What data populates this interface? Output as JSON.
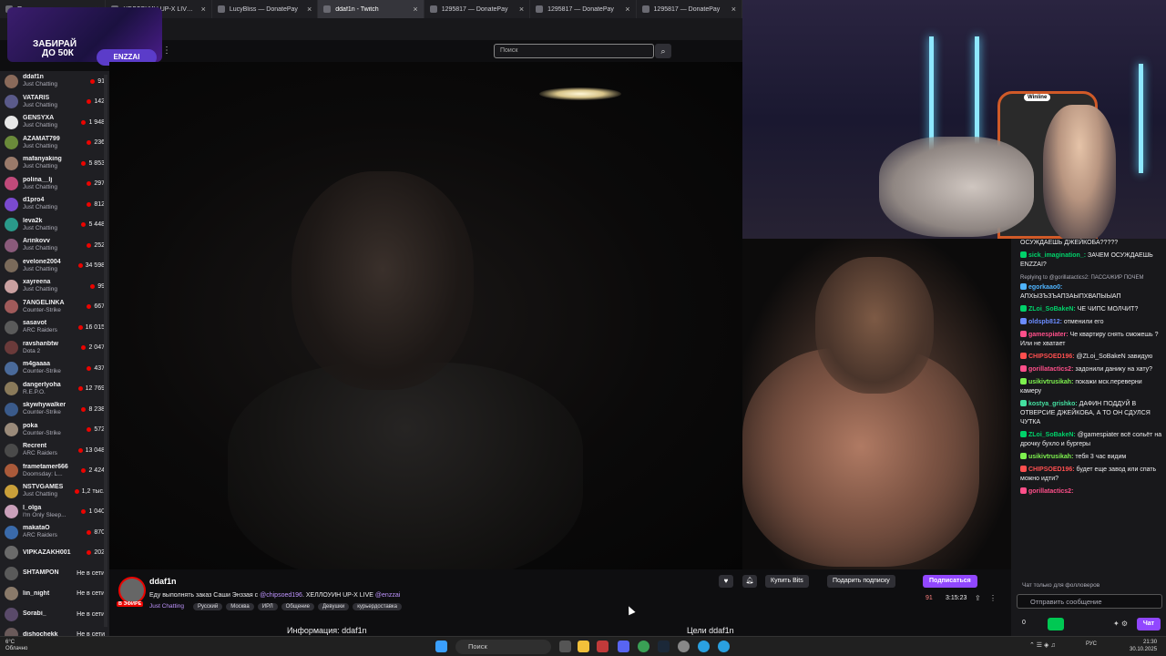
{
  "browser": {
    "tabs": [
      {
        "title": "Панель управления - Donatio",
        "active": false
      },
      {
        "title": "ХЕЛЛОУИН UP-X LIVE - Twitch",
        "active": false
      },
      {
        "title": "LucyBliss — DonatePay",
        "active": false
      },
      {
        "title": "ddaf1n - Twitch",
        "active": true
      },
      {
        "title": "1295817 — DonatePay",
        "active": false
      },
      {
        "title": "1295817 — DonatePay",
        "active": false
      },
      {
        "title": "1295817 — DonatePay",
        "active": false
      }
    ]
  },
  "promo": {
    "line1": "ЗАБИРАЙ",
    "line2": "ДО 50К",
    "badge": "ENZZAI"
  },
  "search": {
    "placeholder": "Поиск"
  },
  "sidebar": {
    "channels": [
      {
        "name": "ddaf1n",
        "category": "Just Chatting",
        "viewers": "91",
        "color": "#8a6a5a"
      },
      {
        "name": "VATARIS",
        "category": "Just Chatting",
        "viewers": "142",
        "color": "#5a5a8a"
      },
      {
        "name": "GENSYXA",
        "category": "Just Chatting",
        "viewers": "1 948",
        "color": "#e8e8e8"
      },
      {
        "name": "AZAMAT799",
        "category": "Just Chatting",
        "viewers": "236",
        "color": "#6a8a3a"
      },
      {
        "name": "mafanyaking",
        "category": "Just Chatting",
        "viewers": "5 853",
        "color": "#9a7a6a"
      },
      {
        "name": "polina__lj",
        "category": "Just Chatting",
        "viewers": "297",
        "color": "#c14a7a"
      },
      {
        "name": "d1pro4",
        "category": "Just Chatting",
        "viewers": "812",
        "color": "#7a4ad0"
      },
      {
        "name": "leva2k",
        "category": "Just Chatting",
        "viewers": "5 448",
        "color": "#2a9a8a"
      },
      {
        "name": "Arinkovv",
        "category": "Just Chatting",
        "viewers": "252",
        "color": "#8a5a7a"
      },
      {
        "name": "evelone2004",
        "category": "Just Chatting",
        "viewers": "34 598",
        "color": "#7a6a5a"
      },
      {
        "name": "xayreena",
        "category": "Just Chatting",
        "viewers": "99",
        "color": "#caa0a0"
      },
      {
        "name": "7ANGELINKA",
        "category": "Counter-Strike",
        "viewers": "667",
        "color": "#a05a5a"
      },
      {
        "name": "sasavot",
        "category": "ARC Raiders",
        "viewers": "16 015",
        "color": "#5a5a5a"
      },
      {
        "name": "ravshanbtw",
        "category": "Dota 2",
        "viewers": "2 047",
        "color": "#6a3a3a"
      },
      {
        "name": "m4gaaaa",
        "category": "Counter-Strike",
        "viewers": "437",
        "color": "#4a6a9a"
      },
      {
        "name": "dangerlyoha",
        "category": "R.E.P.O.",
        "viewers": "12 769",
        "color": "#8a7a5a"
      },
      {
        "name": "skywhywalker",
        "category": "Counter-Strike",
        "viewers": "8 238",
        "color": "#3a5a8a"
      },
      {
        "name": "poka",
        "category": "Counter-Strike",
        "viewers": "572",
        "color": "#9a8a7a"
      },
      {
        "name": "Recrent",
        "category": "ARC Raiders",
        "viewers": "13 048",
        "color": "#4a4a4a"
      },
      {
        "name": "frametamer666",
        "category": "Doomsday: L...",
        "viewers": "2 424",
        "color": "#aa5a3a"
      },
      {
        "name": "NSTVGAMES",
        "category": "Just Chatting",
        "viewers": "1,2 тыс.",
        "color": "#caa03a"
      },
      {
        "name": "l_olga",
        "category": "I'm Only Sleep...",
        "viewers": "1 040",
        "color": "#caa0ba"
      },
      {
        "name": "makataO",
        "category": "ARC Raiders",
        "viewers": "870",
        "color": "#3a6aaa"
      },
      {
        "name": "VIPKAZAKH001",
        "category": "",
        "viewers": "202",
        "color": "#6a6a6a"
      },
      {
        "name": "SHTAMPON",
        "category": "",
        "viewers": "Не в сети",
        "color": "#5a5a5a",
        "offline": true
      },
      {
        "name": "lin_night",
        "category": "",
        "viewers": "Не в сети",
        "color": "#8a7a6a",
        "offline": true
      },
      {
        "name": "Sorabi_",
        "category": "",
        "viewers": "Не в сети",
        "color": "#5a4a6a",
        "offline": true
      },
      {
        "name": "dishochekk",
        "category": "",
        "viewers": "Не в сети",
        "color": "#6a5a5a",
        "offline": true
      }
    ]
  },
  "cam": {
    "sponsor": "Winline"
  },
  "chat": {
    "messages": [
      {
        "user": "",
        "text": "ОСУЖДАЕШЬ ДЖЕЙКОБА?????",
        "color": "#efeff1"
      },
      {
        "user": "sick_imagination_:",
        "text": "ЗАЧЕМ ОСУЖДАЕШЬ ENZZAI?",
        "color": "#00d26a"
      },
      {
        "reply": "Replying to @gorillatactics2: ПАССАЖИР ПОЧЕМ"
      },
      {
        "user": "egorkaao0:",
        "text": "АПХЫЗЪЗЪАПЗАЫПХВАПЫЫАП",
        "color": "#4fb4ff"
      },
      {
        "user": "ZLoi_SoBakeN:",
        "text": "ЧЕ ЧИПС МОЛЧИТ?",
        "color": "#00d26a"
      },
      {
        "user": "oldspb812:",
        "text": "отменили его",
        "color": "#6b8cff"
      },
      {
        "user": "gamespiater:",
        "text": "Че квартиру снять сможешь ? Или не хватает",
        "color": "#ff4f8a"
      },
      {
        "user": "CHIPSOED196:",
        "text": "@ZLoi_SoBakeN завидую",
        "color": "#ff4f4f"
      },
      {
        "user": "gorillatactics2:",
        "text": "задонили данику на хату?",
        "color": "#ff4f8a"
      },
      {
        "user": "usikivtrusikah:",
        "text": "покажи мск.переверни камеру",
        "color": "#7ef24f"
      },
      {
        "user": "kostya_grishko:",
        "text": "ДАФИН ПОДДУЙ В ОТВЕРСИЕ ДЖЕЙКОБА, А ТО ОН СДУЛСЯ ЧУТКА",
        "color": "#44e0a0"
      },
      {
        "user": "ZLoi_SoBakeN:",
        "text": "@gamespiater всё сольёт на дрочку бухло и бургеры",
        "color": "#00d26a"
      },
      {
        "user": "usikivtrusikah:",
        "text": "тебя 3 час видим",
        "color": "#7ef24f"
      },
      {
        "user": "CHIPSOED196:",
        "text": "будет еще завод или спать можно идти?",
        "color": "#ff4f4f"
      },
      {
        "user": "gorillatactics2:",
        "text": "",
        "color": "#ff4f8a"
      }
    ],
    "followers_only": "Чат только для фолловеров",
    "input_placeholder": "Отправить сообщение",
    "points": "0",
    "send_label": "Чат"
  },
  "stream": {
    "channel": "ddaf1n",
    "title_prefix": "Еду выполнять заказ Саши Энззая с",
    "mention1": "@chipsoed196",
    "title_middle": ". ХЕЛЛОУИН UP-X LIVE",
    "mention2": "@enzzai",
    "live_badge": "В ЭФИРЕ",
    "category": "Just Chatting",
    "tags": [
      "Русский",
      "Москва",
      "ИРЛ",
      "Общение",
      "Девушки",
      "курьердоставка"
    ],
    "bits_label": "Купить Bits",
    "gift_label": "Подарить подписку",
    "subscribe_label": "Подписаться",
    "viewers": "91",
    "uptime": "3:15:23",
    "about_label": "Информация: ddaf1n",
    "goals_label": "Цели ddaf1n"
  },
  "taskbar": {
    "weather_temp": "6°C",
    "weather_desc": "Облачно",
    "search_label": "Поиск",
    "lang": "РУС",
    "time": "21:30",
    "date": "30.10.2025"
  }
}
